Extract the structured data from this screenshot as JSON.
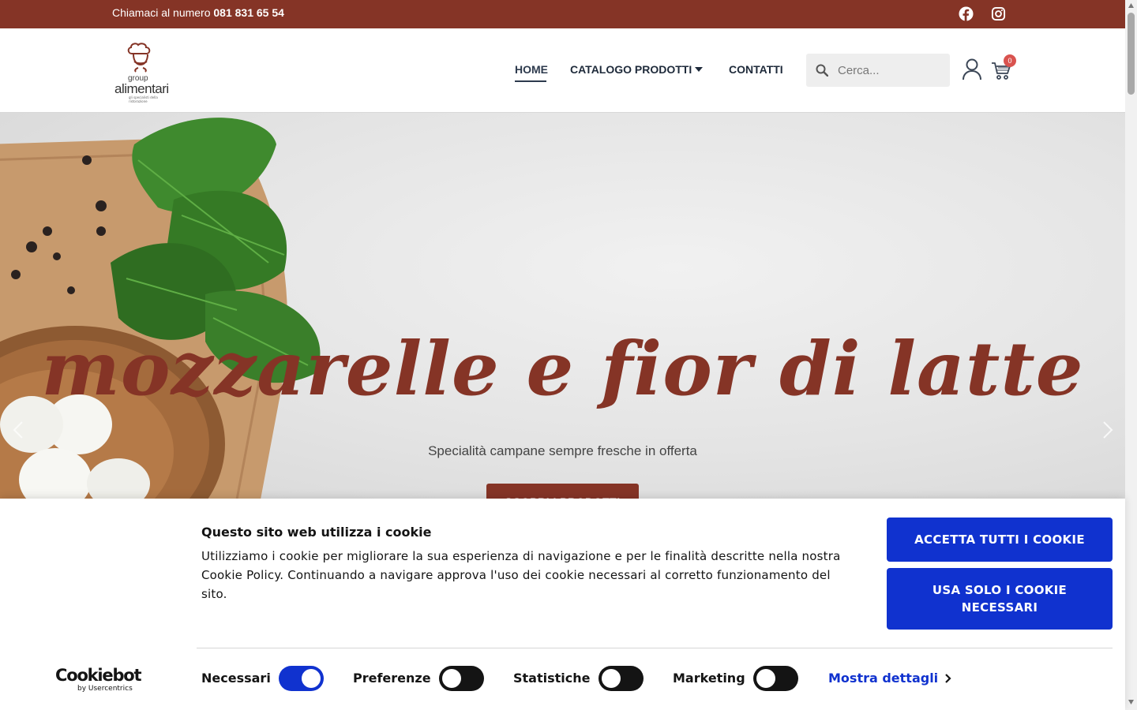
{
  "topbar": {
    "phone_prefix": "Chiamaci al numero ",
    "phone_number": "081 831 65 54",
    "social": [
      "facebook-icon",
      "instagram-icon"
    ]
  },
  "logo": {
    "line1": "group",
    "line2": "alimentari",
    "tagline": "gli specialisti della ristorazione"
  },
  "nav": {
    "home": "HOME",
    "catalog": "CATALOGO PRODOTTI",
    "contacts": "CONTATTI"
  },
  "search": {
    "placeholder": "Cerca..."
  },
  "cart": {
    "count": "0"
  },
  "hero": {
    "title": "mozzarelle e fior di latte",
    "subtitle": "Specialità campane sempre fresche in offerta",
    "cta": "SCOPRI I PRODOTTI"
  },
  "cookie": {
    "title": "Questo sito web utilizza i cookie",
    "text": "Utilizziamo i cookie per migliorare la sua esperienza di navigazione e per le finalità descritte nella nostra Cookie Policy. Continuando a navigare approva l'uso dei cookie necessari al corretto funzionamento del sito.",
    "accept_all": "ACCETTA TUTTI I COOKIE",
    "only_necessary": "USA SOLO I COOKIE NECESSARI",
    "brand": "Cookiebot",
    "brand_sub": "by Usercentrics",
    "toggles": [
      {
        "label": "Necessari",
        "on": true
      },
      {
        "label": "Preferenze",
        "on": false
      },
      {
        "label": "Statistiche",
        "on": false
      },
      {
        "label": "Marketing",
        "on": false
      }
    ],
    "details": "Mostra dettagli"
  },
  "colors": {
    "brand": "#853426",
    "cookie_accent": "#1032cf",
    "nav_text": "#1e2a3a"
  }
}
